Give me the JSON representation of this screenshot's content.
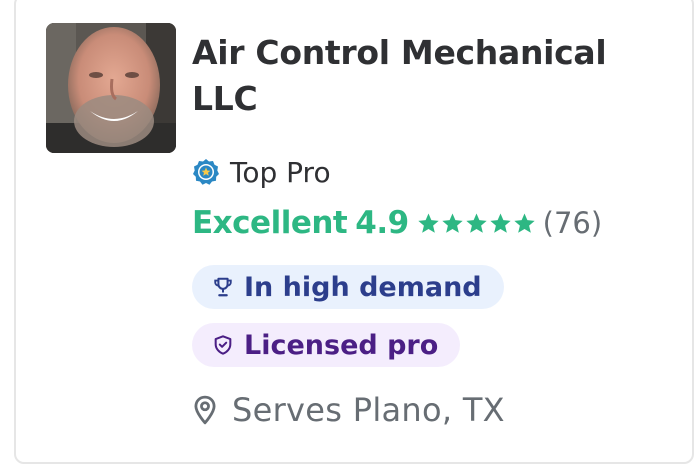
{
  "pro": {
    "name": "Air Control Mechanical LLC",
    "avatar_icon": "profile-photo",
    "top_pro": {
      "label": "Top Pro",
      "icon": "top-pro-badge-icon"
    },
    "rating": {
      "word": "Excellent",
      "score": "4.9",
      "stars": 5,
      "count": "(76)"
    },
    "badges": [
      {
        "label": "In high demand",
        "icon": "trophy-icon"
      },
      {
        "label": "Licensed pro",
        "icon": "shield-check-icon"
      }
    ],
    "serves": {
      "text": "Serves Plano, TX",
      "icon": "location-pin-icon"
    }
  },
  "colors": {
    "rating_green": "#2db783",
    "demand_bg": "#e9f1fd",
    "demand_text": "#2c3e8c",
    "licensed_bg": "#f4edfd",
    "licensed_text": "#4b1f85",
    "top_pro_blue": "#2b88c4"
  }
}
